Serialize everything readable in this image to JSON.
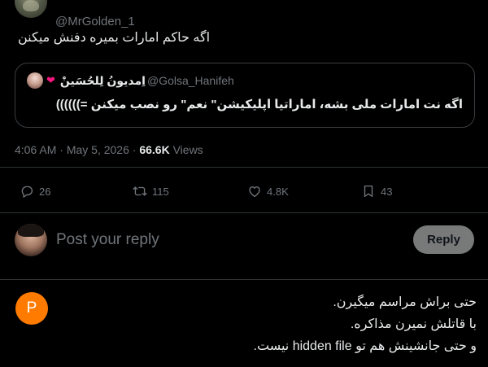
{
  "author": {
    "handle": "@MrGolden_1"
  },
  "tweet": {
    "text": "اگه حاکم امارات بمیره دفنش میکنن"
  },
  "quote": {
    "display_name": "اِمدیونُ لِلحُسَینْ",
    "badge_icon": "heart-hands-emoji",
    "handle": "@Golsa_Hanifeh",
    "text": "اگه نت امارات ملی بشه، اماراتیا اپلیکیشن\" نعم\" رو نصب میکنن =))))))"
  },
  "meta": {
    "time": "4:06 AM",
    "separator": " · ",
    "date": "May 5, 2026",
    "separator2": " · ",
    "views_count": "66.6K",
    "views_label": " Views"
  },
  "actions": {
    "replies": "26",
    "reposts": "115",
    "likes": "4.8K",
    "bookmarks": "43"
  },
  "composer": {
    "placeholder": "Post your reply",
    "button_label": "Reply"
  },
  "comment": {
    "avatar_letter": "P",
    "avatar_color": "#ff7b00",
    "lines": [
      "حتی براش مراسم میگیرن.",
      "با قاتلش نمیرن مذاکره.",
      "و حتی جانشینش هم تو hidden file نیست."
    ]
  },
  "colors": {
    "background": "#000000",
    "text_primary": "#e7e9ea",
    "text_secondary": "#71767b",
    "border": "#2f3336",
    "like_accent": "#f91880"
  }
}
